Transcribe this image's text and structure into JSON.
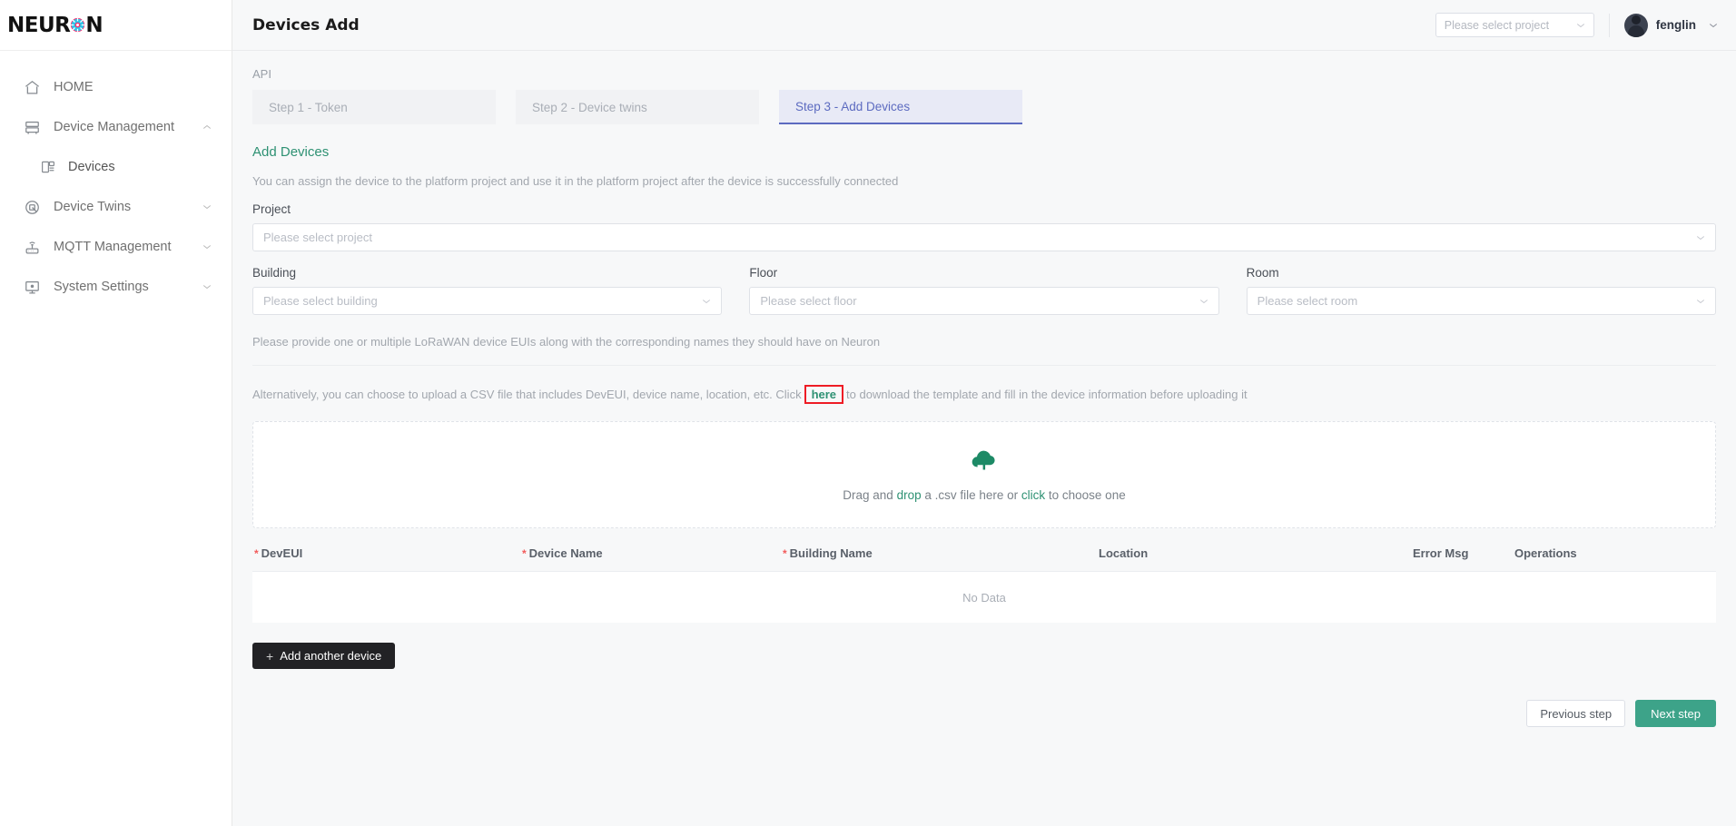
{
  "brand": {
    "name_part1": "NEUR",
    "name_part2": "N",
    "logo_icon": "neuron-spark-icon",
    "accent_pink": "#ff2d6f",
    "accent_cyan": "#2bc4e8"
  },
  "sidebar": {
    "items": [
      {
        "label": "HOME",
        "icon": "home-icon",
        "caret": "",
        "sub": false
      },
      {
        "label": "Device Management",
        "icon": "server-icon",
        "caret": "up",
        "sub": false
      },
      {
        "label": "Devices",
        "icon": "device-list-icon",
        "caret": "",
        "sub": true
      },
      {
        "label": "Device Twins",
        "icon": "twins-circle-icon",
        "caret": "down",
        "sub": false
      },
      {
        "label": "MQTT Management",
        "icon": "router-icon",
        "caret": "down",
        "sub": false
      },
      {
        "label": "System Settings",
        "icon": "monitor-icon",
        "caret": "down",
        "sub": false
      }
    ]
  },
  "topbar": {
    "title": "Devices Add",
    "project_select_placeholder": "Please select project",
    "user_name": "fenglin",
    "avatar_icon": "user-avatar",
    "caret_icon": "chevron-down-icon"
  },
  "api_section": {
    "label": "API",
    "steps": [
      {
        "label": "Step 1 - Token",
        "active": false
      },
      {
        "label": "Step 2 - Device twins",
        "active": false
      },
      {
        "label": "Step 3 - Add Devices",
        "active": true
      }
    ]
  },
  "form": {
    "heading": "Add Devices",
    "description": "You can assign the device to the platform project and use it in the platform project after the device is successfully connected",
    "project_label": "Project",
    "project_placeholder": "Please select project",
    "building_label": "Building",
    "building_placeholder": "Please select building",
    "floor_label": "Floor",
    "floor_placeholder": "Please select floor",
    "room_label": "Room",
    "room_placeholder": "Please select room"
  },
  "notes": {
    "line1": "Please provide one or multiple LoRaWAN device EUIs along with the corresponding names they should have on Neuron",
    "line2_prefix": "Alternatively, you can choose to upload a CSV file that includes DevEUI, device name, location, etc. Click",
    "line2_link": "here",
    "line2_suffix": "to download the template and fill in the device information before uploading it",
    "highlight_color": "#ee1c25"
  },
  "dropzone": {
    "icon": "cloud-upload-icon",
    "text_pre": "Drag and ",
    "text_link1": "drop",
    "text_mid": " a .csv file here or ",
    "text_link2": "click",
    "text_post": " to choose one",
    "accent": "#2e9173"
  },
  "table": {
    "columns": [
      {
        "label": "DevEUI",
        "required": true
      },
      {
        "label": "Device Name",
        "required": true
      },
      {
        "label": "Building Name",
        "required": true
      },
      {
        "label": "Location",
        "required": false
      },
      {
        "label": "Error Msg",
        "required": false
      },
      {
        "label": "Operations",
        "required": false
      }
    ],
    "empty_text": "No Data",
    "add_row_label": "Add another device",
    "add_row_icon": "plus-icon"
  },
  "footer": {
    "previous_label": "Previous step",
    "next_label": "Next step",
    "next_color": "#3da389"
  }
}
